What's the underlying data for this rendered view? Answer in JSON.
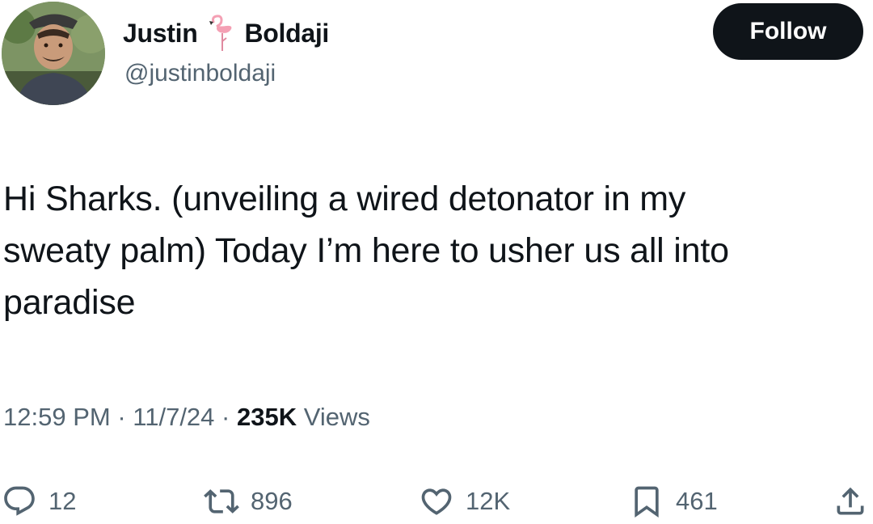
{
  "author": {
    "first_name": "Justin",
    "last_name": "Boldaji",
    "emoji_icon": "flamingo-icon",
    "handle": "@justinboldaji"
  },
  "follow_button": {
    "label": "Follow"
  },
  "tweet": {
    "lines": [
      "Hi Sharks. (unveiling a wired detonator in my",
      "sweaty palm) Today I’m here to usher us all into",
      "paradise"
    ]
  },
  "meta": {
    "time": "12:59 PM",
    "separator": "·",
    "date": "11/7/24",
    "views_count": "235K",
    "views_label": "Views"
  },
  "actions": {
    "replies": {
      "icon": "reply-icon",
      "count": "12"
    },
    "reposts": {
      "icon": "repost-icon",
      "count": "896"
    },
    "likes": {
      "icon": "heart-icon",
      "count": "12K"
    },
    "bookmarks": {
      "icon": "bookmark-icon",
      "count": "461"
    },
    "share": {
      "icon": "share-icon"
    }
  },
  "colors": {
    "text": "#0f1419",
    "secondary": "#536471",
    "button_bg": "#0f1419",
    "button_text": "#ffffff",
    "flamingo": "#f4a0b4"
  }
}
